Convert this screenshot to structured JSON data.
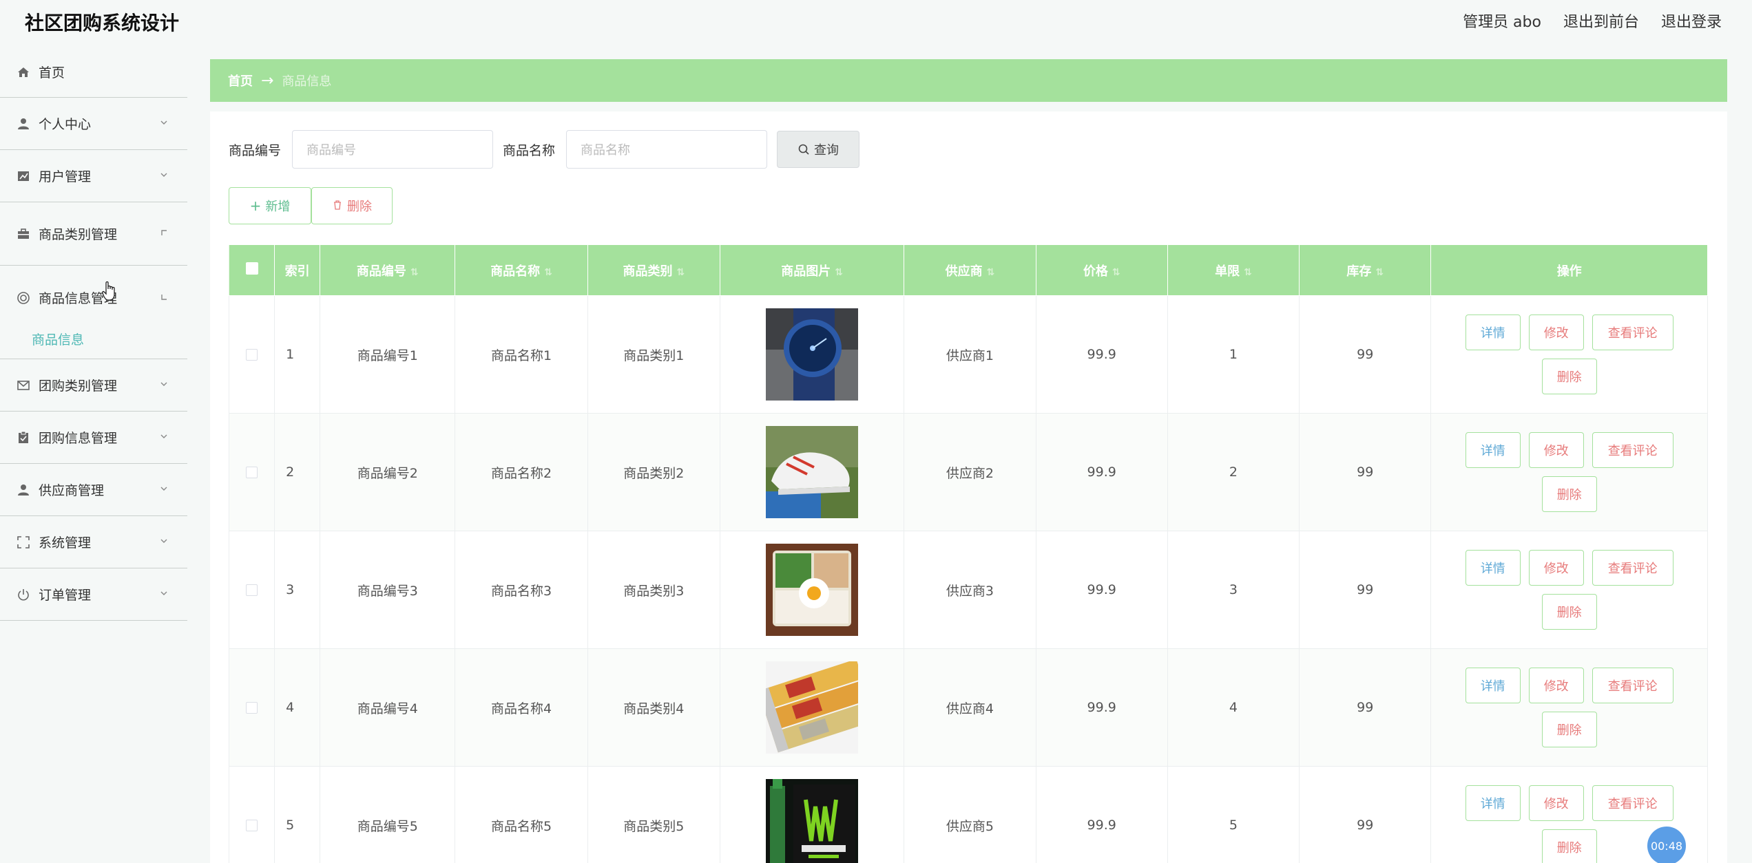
{
  "app": {
    "title": "社区团购系统设计"
  },
  "header": {
    "user_label": "管理员 abo",
    "front_link": "退出到前台",
    "logout": "退出登录"
  },
  "sidebar": {
    "items": [
      {
        "label": "首页",
        "icon": "home-icon"
      },
      {
        "label": "个人中心",
        "icon": "user-icon"
      },
      {
        "label": "用户管理",
        "icon": "chart-icon"
      },
      {
        "label": "商品类别管理",
        "icon": "briefcase-icon"
      },
      {
        "label": "商品信息管理",
        "icon": "lifebuoy-icon",
        "submenu": "商品信息"
      },
      {
        "label": "团购类别管理",
        "icon": "mail-icon"
      },
      {
        "label": "团购信息管理",
        "icon": "clipboard-icon"
      },
      {
        "label": "供应商管理",
        "icon": "user-icon"
      },
      {
        "label": "系统管理",
        "icon": "expand-icon"
      },
      {
        "label": "订单管理",
        "icon": "power-icon"
      }
    ]
  },
  "breadcrumb": {
    "home": "首页",
    "arrow": "→",
    "current": "商品信息"
  },
  "search": {
    "code_label": "商品编号",
    "code_placeholder": "商品编号",
    "name_label": "商品名称",
    "name_placeholder": "商品名称",
    "query_button": "查询"
  },
  "actions": {
    "add": "新增",
    "delete": "删除"
  },
  "table": {
    "headers": [
      "索引",
      "商品编号",
      "商品名称",
      "商品类别",
      "商品图片",
      "供应商",
      "价格",
      "单限",
      "库存",
      "操作"
    ],
    "rows": [
      {
        "index": "1",
        "code": "商品编号1",
        "name": "商品名称1",
        "category": "商品类别1",
        "image": "watch-photo",
        "supplier": "供应商1",
        "price": "99.9",
        "limit": "1",
        "stock": "99"
      },
      {
        "index": "2",
        "code": "商品编号2",
        "name": "商品名称2",
        "category": "商品类别2",
        "image": "sneaker-photo",
        "supplier": "供应商2",
        "price": "99.9",
        "limit": "2",
        "stock": "99"
      },
      {
        "index": "3",
        "code": "商品编号3",
        "name": "商品名称3",
        "category": "商品类别3",
        "image": "bento-photo",
        "supplier": "供应商3",
        "price": "99.9",
        "limit": "3",
        "stock": "99"
      },
      {
        "index": "4",
        "code": "商品编号4",
        "name": "商品名称4",
        "category": "商品类别4",
        "image": "chips-can-photo",
        "supplier": "供应商4",
        "price": "99.9",
        "limit": "4",
        "stock": "99"
      },
      {
        "index": "5",
        "code": "商品编号5",
        "name": "商品名称5",
        "category": "商品类别5",
        "image": "energy-drink-photo",
        "supplier": "供应商5",
        "price": "99.9",
        "limit": "5",
        "stock": "99"
      }
    ],
    "row_ops": {
      "detail": "详情",
      "edit": "修改",
      "review": "查看评论",
      "delete": "删除"
    }
  },
  "timer": "00:48",
  "colors": {
    "accent": "#a4e19c",
    "teal": "#4fb8b5",
    "danger": "#e77b7b",
    "info": "#5fa9d6"
  }
}
